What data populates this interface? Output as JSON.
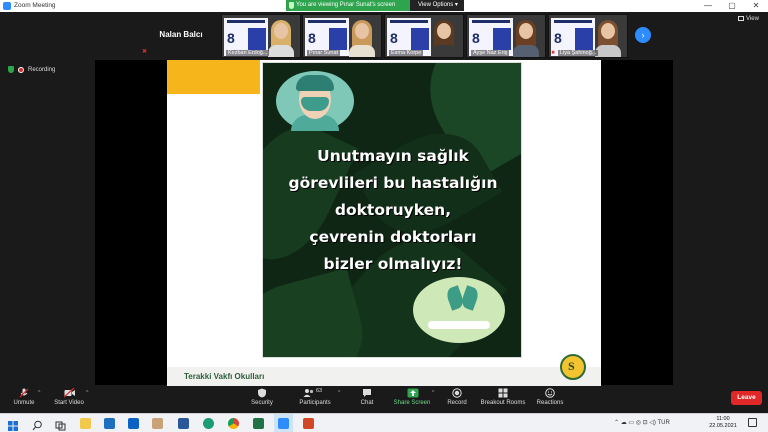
{
  "window": {
    "title": "Zoom Meeting",
    "controls": [
      "—",
      "▢",
      "✕"
    ]
  },
  "share_banner": {
    "viewing_text": "You are viewing Pınar Sunat's screen",
    "view_options_label": "View Options ▾"
  },
  "strip": {
    "speaker_name": "Nalan Balcı",
    "participants": [
      {
        "name": "Kezban Erdoğ..."
      },
      {
        "name": "Pınar Sunat"
      },
      {
        "name": "Esma Korpe"
      },
      {
        "name": "Ayşe Naz Eriş"
      },
      {
        "name": "Liya Şahinoğ..."
      }
    ],
    "view_label": "View",
    "poster_number": "8"
  },
  "recording": {
    "label": "Recording"
  },
  "slide": {
    "headline_lines": [
      "Unutmayın sağlık",
      "görevlileri bu hastalığın",
      "doktoruyken,",
      "çevrenin doktorları",
      "bizler olmalıyız!"
    ],
    "footer_text": "Terakki Vakfı Okulları",
    "seal_letter": "S"
  },
  "toolbar": {
    "unmute": "Unmute",
    "start_video": "Start Video",
    "security": "Security",
    "participants": "Participants",
    "participants_count": "63",
    "chat": "Chat",
    "share_screen": "Share Screen",
    "record": "Record",
    "breakout_rooms": "Breakout Rooms",
    "reactions": "Reactions",
    "leave": "Leave"
  },
  "taskbar": {
    "tray_text": "⌃  ☁  ▭  ◎  ⊡  ◁)  TUR",
    "time": "11:00",
    "date": "22.05.2021"
  },
  "colors": {
    "zoom_blue": "#2d8cff",
    "leave_red": "#e02828",
    "banner_green": "#2ea44f",
    "slide_yellow": "#f7b51c"
  }
}
